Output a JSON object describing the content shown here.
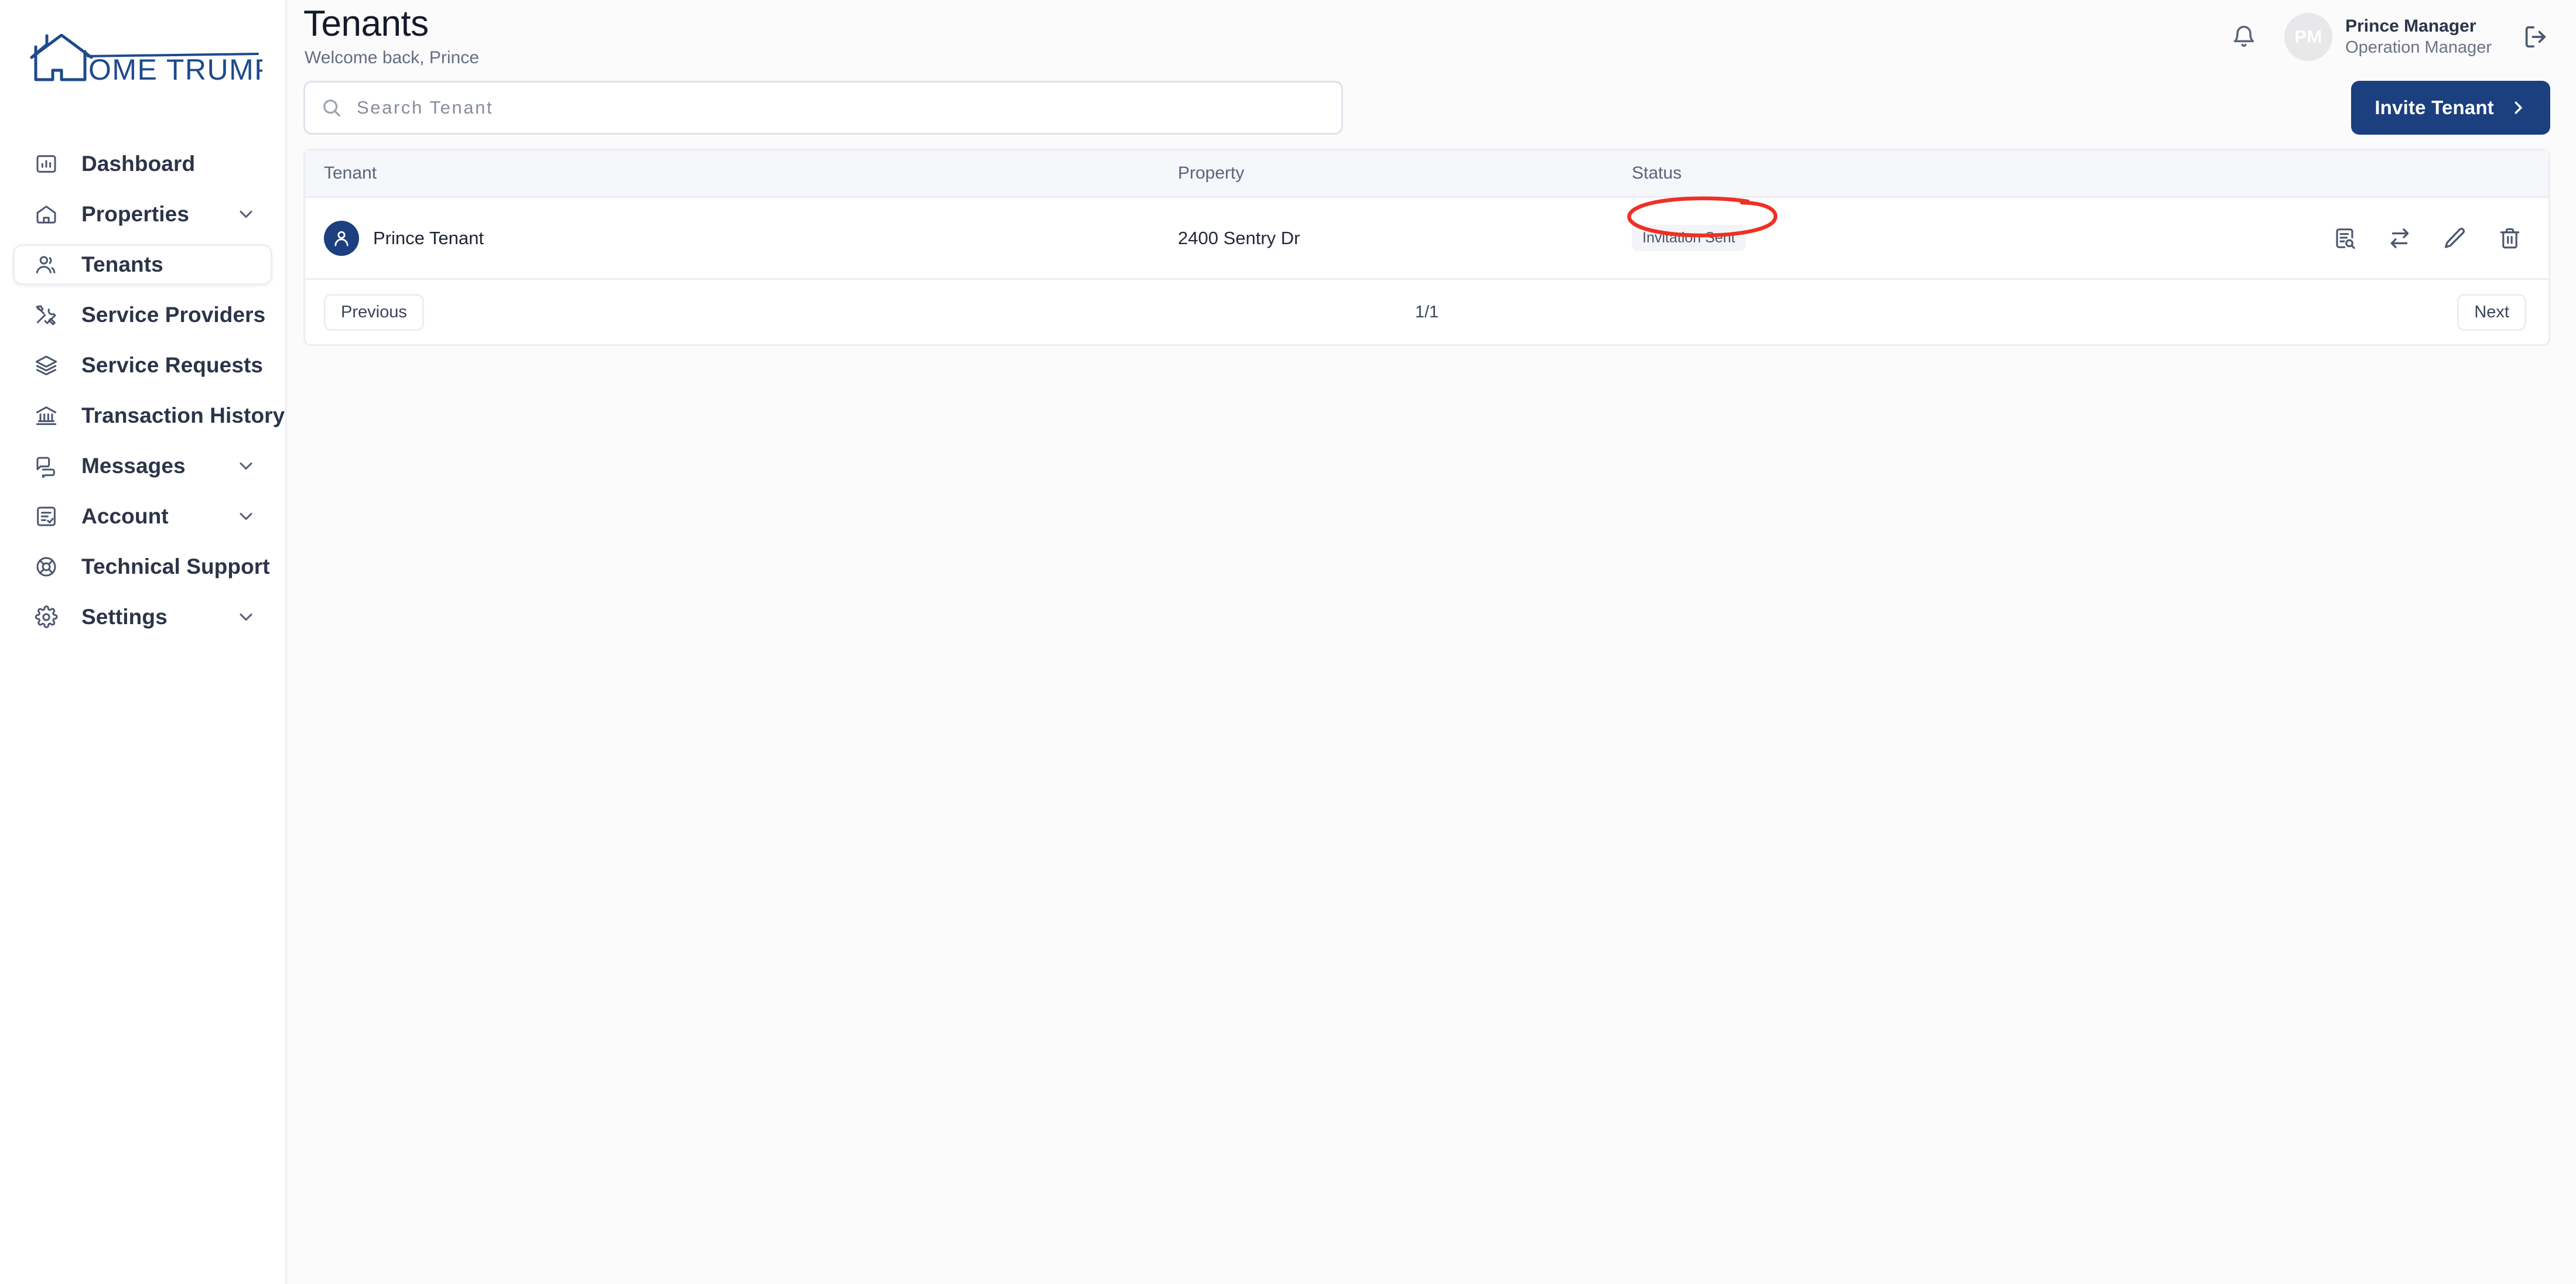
{
  "brand": {
    "logo_text": "OME TRUMPETER",
    "full_name": "HOME TRUMPETER",
    "color": "#1e4a8c"
  },
  "sidebar": {
    "items": [
      {
        "label": "Dashboard",
        "icon": "chart-bar-icon",
        "active": false,
        "expandable": false
      },
      {
        "label": "Properties",
        "icon": "home-icon",
        "active": false,
        "expandable": true
      },
      {
        "label": "Tenants",
        "icon": "users-icon",
        "active": true,
        "expandable": false
      },
      {
        "label": "Service Providers",
        "icon": "tools-icon",
        "active": false,
        "expandable": false
      },
      {
        "label": "Service Requests",
        "icon": "layers-icon",
        "active": false,
        "expandable": false
      },
      {
        "label": "Transaction History",
        "icon": "bank-icon",
        "active": false,
        "expandable": false
      },
      {
        "label": "Messages",
        "icon": "chat-bubbles-icon",
        "active": false,
        "expandable": true
      },
      {
        "label": "Account",
        "icon": "document-check-icon",
        "active": false,
        "expandable": true
      },
      {
        "label": "Technical Support",
        "icon": "lifebuoy-icon",
        "active": false,
        "expandable": false
      },
      {
        "label": "Settings",
        "icon": "gear-icon",
        "active": false,
        "expandable": true
      }
    ]
  },
  "header": {
    "title": "Tenants",
    "subtitle": "Welcome back, Prince",
    "notification_icon": "bell-icon",
    "logout_icon": "logout-icon",
    "user": {
      "initials": "PM",
      "name": "Prince Manager",
      "role": "Operation Manager"
    }
  },
  "toolbar": {
    "search": {
      "icon": "search-icon",
      "placeholder": "Search Tenant",
      "value": ""
    },
    "invite_button": {
      "label": "Invite Tenant",
      "icon": "chevron-right-icon",
      "color": "#1b3f7f"
    }
  },
  "table": {
    "columns": [
      "Tenant",
      "Property",
      "Status",
      ""
    ],
    "rows": [
      {
        "avatar_icon": "user-avatar-icon",
        "tenant": "Prince Tenant",
        "property": "2400 Sentry Dr",
        "status": "Invitation Sent",
        "actions": [
          {
            "name": "view-details-icon",
            "title": "View details"
          },
          {
            "name": "transfer-icon",
            "title": "Transfer"
          },
          {
            "name": "edit-pencil-icon",
            "title": "Edit"
          },
          {
            "name": "delete-trash-icon",
            "title": "Delete"
          }
        ]
      }
    ]
  },
  "pagination": {
    "previous_label": "Previous",
    "next_label": "Next",
    "indicator": "1/1"
  },
  "annotation": {
    "shape": "ellipse",
    "color": "#ee3124",
    "target": "status-badge"
  }
}
